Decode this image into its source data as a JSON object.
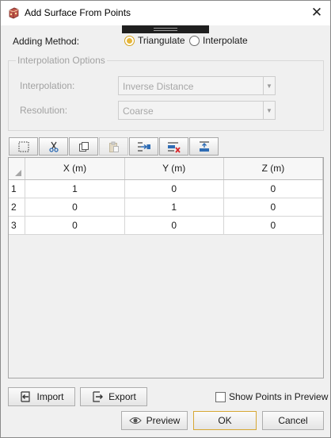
{
  "window": {
    "title": "Add Surface From Points",
    "icon": "surface-points-app-icon",
    "close_glyph": "✕"
  },
  "adding_method": {
    "label": "Adding Method:",
    "options": [
      {
        "label": "Triangulate",
        "selected": true
      },
      {
        "label": "Interpolate",
        "selected": false
      }
    ]
  },
  "interpolation_options": {
    "legend": "Interpolation Options",
    "interpolation": {
      "label": "Interpolation:",
      "value": "Inverse Distance"
    },
    "resolution": {
      "label": "Resolution:",
      "value": "Coarse"
    }
  },
  "toolbar": {
    "buttons": [
      {
        "icon": "select-all-icon",
        "enabled": true
      },
      {
        "icon": "cut-icon",
        "enabled": true
      },
      {
        "icon": "copy-icon",
        "enabled": true
      },
      {
        "icon": "paste-icon",
        "enabled": false
      },
      {
        "icon": "insert-row-icon",
        "enabled": true
      },
      {
        "icon": "delete-row-icon",
        "enabled": true
      },
      {
        "icon": "append-row-icon",
        "enabled": true
      }
    ]
  },
  "table": {
    "columns": [
      "X (m)",
      "Y (m)",
      "Z (m)"
    ],
    "rows": [
      {
        "index": "1",
        "cells": [
          "1",
          "0",
          "0"
        ]
      },
      {
        "index": "2",
        "cells": [
          "0",
          "1",
          "0"
        ]
      },
      {
        "index": "3",
        "cells": [
          "0",
          "0",
          "0"
        ]
      }
    ]
  },
  "footer": {
    "import_label": "Import",
    "export_label": "Export",
    "show_points_label": "Show Points in Preview",
    "show_points_checked": false,
    "preview_label": "Preview",
    "ok_label": "OK",
    "cancel_label": "Cancel"
  },
  "colors": {
    "accent": "#e6b53a",
    "dialog_bg": "#f0f0f0",
    "disabled_text": "#a2a2a2",
    "delete_red": "#d9262b",
    "icon_blue": "#2f6db5"
  }
}
